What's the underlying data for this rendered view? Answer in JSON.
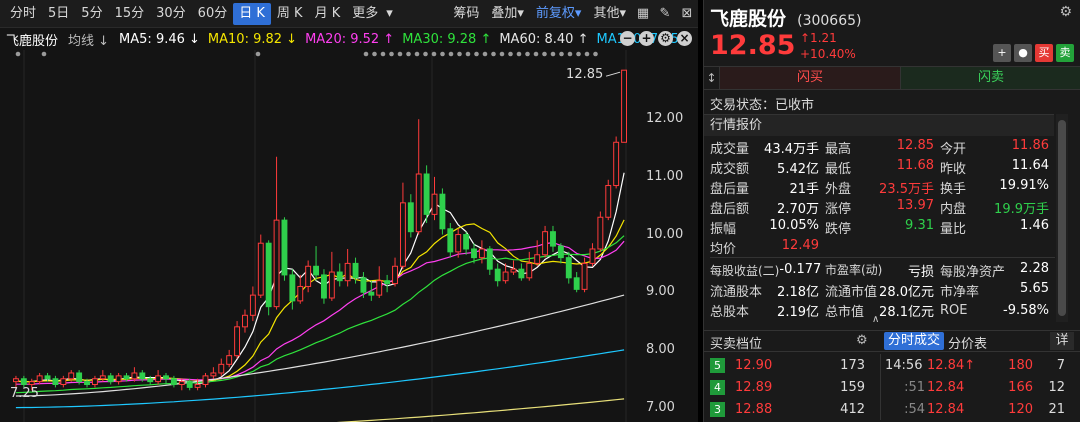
{
  "toolbar": {
    "periods": [
      "分时",
      "5日",
      "5分",
      "15分",
      "30分",
      "60分",
      "日 K",
      "周 K",
      "月 K",
      "更多"
    ],
    "active_period": "日 K",
    "more_arrow": "▾",
    "tools": [
      "筹码",
      "叠加",
      "前复权",
      "其他"
    ],
    "tool_arrow": "▾"
  },
  "ma_legend": {
    "stock_name": "飞鹿股份",
    "junxian": "均线 ↓",
    "items": [
      {
        "text": "MA5: 9.46 ↓",
        "color": "#ffffff"
      },
      {
        "text": "MA10: 9.82 ↓",
        "color": "#f5e600"
      },
      {
        "text": "MA20: 9.52 ↑",
        "color": "#ff3ff0"
      },
      {
        "text": "MA30: 9.28 ↑",
        "color": "#2fe23c"
      },
      {
        "text": "MA60: 8.40 ↑",
        "color": "#e6e6e6"
      },
      {
        "text": "MA120: 7.65",
        "color": "#1ec8ff"
      }
    ],
    "icons": [
      "−",
      "+",
      "⚙",
      "×"
    ]
  },
  "price_axis": [
    "12.00",
    "11.00",
    "10.00",
    "9.00",
    "8.00",
    "7.00"
  ],
  "annotations": {
    "high": "12.85",
    "low": "7.25"
  },
  "colors": {
    "up": "#ff3b3b",
    "down": "#2fd04c",
    "accent": "#2f6fd6"
  },
  "chart_data": {
    "type": "candlestick",
    "ylim": [
      6.75,
      13.2
    ],
    "candles": [
      [
        7.45,
        7.5,
        7.55,
        7.3
      ],
      [
        7.5,
        7.4,
        7.55,
        7.35
      ],
      [
        7.4,
        7.45,
        7.5,
        7.3
      ],
      [
        7.45,
        7.55,
        7.6,
        7.4
      ],
      [
        7.55,
        7.5,
        7.6,
        7.45
      ],
      [
        7.5,
        7.4,
        7.55,
        7.35
      ],
      [
        7.4,
        7.5,
        7.55,
        7.35
      ],
      [
        7.5,
        7.6,
        7.65,
        7.45
      ],
      [
        7.6,
        7.45,
        7.65,
        7.4
      ],
      [
        7.45,
        7.4,
        7.5,
        7.35
      ],
      [
        7.4,
        7.5,
        7.55,
        7.35
      ],
      [
        7.5,
        7.55,
        7.65,
        7.45
      ],
      [
        7.55,
        7.45,
        7.6,
        7.4
      ],
      [
        7.45,
        7.55,
        7.6,
        7.4
      ],
      [
        7.55,
        7.5,
        7.6,
        7.45
      ],
      [
        7.5,
        7.6,
        7.7,
        7.45
      ],
      [
        7.6,
        7.5,
        7.65,
        7.45
      ],
      [
        7.5,
        7.45,
        7.55,
        7.4
      ],
      [
        7.45,
        7.55,
        7.65,
        7.4
      ],
      [
        7.55,
        7.5,
        7.6,
        7.4
      ],
      [
        7.5,
        7.4,
        7.55,
        7.35
      ],
      [
        7.4,
        7.45,
        7.5,
        7.3
      ],
      [
        7.45,
        7.35,
        7.5,
        7.3
      ],
      [
        7.35,
        7.4,
        7.5,
        7.3
      ],
      [
        7.4,
        7.55,
        7.6,
        7.35
      ],
      [
        7.55,
        7.6,
        7.7,
        7.5
      ],
      [
        7.6,
        7.75,
        7.85,
        7.55
      ],
      [
        7.75,
        7.9,
        8.0,
        7.7
      ],
      [
        7.9,
        8.4,
        8.5,
        7.85
      ],
      [
        8.4,
        8.6,
        8.7,
        8.3
      ],
      [
        8.6,
        8.95,
        9.1,
        8.5
      ],
      [
        8.95,
        9.85,
        10.0,
        8.9
      ],
      [
        9.85,
        8.75,
        9.9,
        8.6
      ],
      [
        8.75,
        10.25,
        11.35,
        8.7
      ],
      [
        10.25,
        9.3,
        10.3,
        9.2
      ],
      [
        9.3,
        8.85,
        9.4,
        8.7
      ],
      [
        8.85,
        9.1,
        9.3,
        8.8
      ],
      [
        9.1,
        9.45,
        9.55,
        9.0
      ],
      [
        9.45,
        9.3,
        9.8,
        9.2
      ],
      [
        9.3,
        8.9,
        9.4,
        8.8
      ],
      [
        8.9,
        9.35,
        9.7,
        8.85
      ],
      [
        9.35,
        9.2,
        9.5,
        9.1
      ],
      [
        9.2,
        9.5,
        9.75,
        9.1
      ],
      [
        9.5,
        9.25,
        9.6,
        9.15
      ],
      [
        9.25,
        9.0,
        9.35,
        8.9
      ],
      [
        9.0,
        8.95,
        9.2,
        8.85
      ],
      [
        8.95,
        9.2,
        9.45,
        8.9
      ],
      [
        9.2,
        9.15,
        9.3,
        9.0
      ],
      [
        9.15,
        9.45,
        9.6,
        9.1
      ],
      [
        9.45,
        10.55,
        10.9,
        9.4
      ],
      [
        10.55,
        10.05,
        10.7,
        9.95
      ],
      [
        10.05,
        11.05,
        12.0,
        10.0
      ],
      [
        11.05,
        10.35,
        11.2,
        10.2
      ],
      [
        10.35,
        10.7,
        11.0,
        10.25
      ],
      [
        10.7,
        10.1,
        10.8,
        10.0
      ],
      [
        10.1,
        9.7,
        10.2,
        9.6
      ],
      [
        9.7,
        10.0,
        10.1,
        9.6
      ],
      [
        10.0,
        9.75,
        10.05,
        9.65
      ],
      [
        9.75,
        9.6,
        9.85,
        9.5
      ],
      [
        9.6,
        9.75,
        9.9,
        9.5
      ],
      [
        9.75,
        9.4,
        9.8,
        9.3
      ],
      [
        9.4,
        9.2,
        9.5,
        9.1
      ],
      [
        9.2,
        9.35,
        9.5,
        9.15
      ],
      [
        9.35,
        9.4,
        9.55,
        9.3
      ],
      [
        9.4,
        9.25,
        9.5,
        9.2
      ],
      [
        9.25,
        9.5,
        9.7,
        9.2
      ],
      [
        9.5,
        9.65,
        9.9,
        9.45
      ],
      [
        9.65,
        10.05,
        10.15,
        9.6
      ],
      [
        10.05,
        9.8,
        10.15,
        9.7
      ],
      [
        9.8,
        9.6,
        9.85,
        9.5
      ],
      [
        9.6,
        9.25,
        9.7,
        9.15
      ],
      [
        9.25,
        9.05,
        9.35,
        9.0
      ],
      [
        9.05,
        9.5,
        9.6,
        9.0
      ],
      [
        9.5,
        9.75,
        9.85,
        9.45
      ],
      [
        9.75,
        10.3,
        10.4,
        9.7
      ],
      [
        10.3,
        10.85,
        10.95,
        10.25
      ],
      [
        10.85,
        11.6,
        11.7,
        10.8
      ],
      [
        11.6,
        12.85,
        12.85,
        11.6
      ]
    ]
  },
  "quote": {
    "name": "飞鹿股份",
    "code": "(300665)",
    "price": "12.85",
    "change": "↑1.21",
    "change_pct": "+10.40%",
    "buttons": [
      "+",
      "●",
      "买",
      "卖"
    ],
    "flash_lead": "↕",
    "flash_buy": "闪买",
    "flash_sell": "闪卖",
    "status": "交易状态：已收市",
    "section_title": "行情报价",
    "rows": [
      [
        [
          "成交量",
          "43.4万手",
          ""
        ],
        [
          "最高",
          "12.85",
          "red"
        ],
        [
          "今开",
          "11.86",
          "red"
        ]
      ],
      [
        [
          "成交额",
          "5.42亿",
          ""
        ],
        [
          "最低",
          "11.68",
          "red"
        ],
        [
          "昨收",
          "11.64",
          ""
        ]
      ],
      [
        [
          "盘后量",
          "21手",
          ""
        ],
        [
          "外盘",
          "23.5万手",
          "red"
        ],
        [
          "换手",
          "19.91%",
          ""
        ]
      ],
      [
        [
          "盘后额",
          "2.70万",
          ""
        ],
        [
          "涨停",
          "13.97",
          "red"
        ],
        [
          "内盘",
          "19.9万手",
          "green"
        ]
      ],
      [
        [
          "振幅",
          "10.05%",
          ""
        ],
        [
          "跌停",
          "9.31",
          "green"
        ],
        [
          "量比",
          "1.46",
          ""
        ]
      ],
      [
        [
          "均价",
          "12.49",
          "red"
        ]
      ]
    ],
    "fin_rows": [
      [
        [
          "每股收益(二)",
          "-0.177"
        ],
        [
          "市盈率(动)",
          "亏损"
        ],
        [
          "每股净资产",
          "2.28"
        ]
      ],
      [
        [
          "流通股本",
          "2.18亿"
        ],
        [
          "流通市值",
          "28.0亿元"
        ],
        [
          "市净率",
          "5.65"
        ]
      ],
      [
        [
          "总股本",
          "2.19亿"
        ],
        [
          "总市值",
          "28.1亿元"
        ],
        [
          "ROE",
          "-9.58%"
        ]
      ]
    ],
    "collapse": "∧"
  },
  "orderbook": {
    "title": "买卖档位",
    "tab_active": "分时成交",
    "tab_other": "分价表",
    "detail": "详",
    "asks": [
      {
        "lvl": "5",
        "price": "12.90",
        "vol": "173"
      },
      {
        "lvl": "4",
        "price": "12.89",
        "vol": "159"
      },
      {
        "lvl": "3",
        "price": "12.88",
        "vol": "412"
      }
    ],
    "ticks": [
      {
        "time": "14:56",
        "price": "12.84↑",
        "vol": "180",
        "n": "7",
        "dim": false
      },
      {
        "time": ":51",
        "price": "12.84",
        "vol": "166",
        "n": "12",
        "dim": true
      },
      {
        "time": ":54",
        "price": "12.84",
        "vol": "120",
        "n": "21",
        "dim": true
      }
    ]
  }
}
